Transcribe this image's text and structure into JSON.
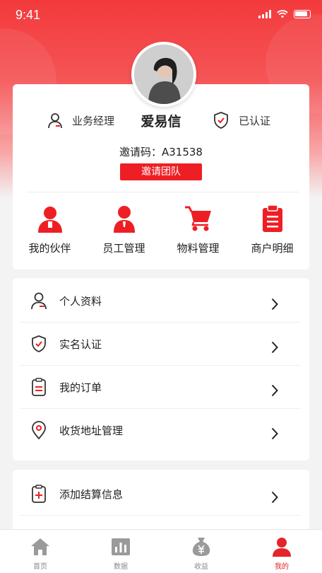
{
  "status_bar": {
    "time": "9:41"
  },
  "profile": {
    "role": "业务经理",
    "name": "爱易信",
    "verified": "已认证",
    "invite_code": "邀请码：A31538",
    "invite_button": "邀请团队"
  },
  "quick_actions": [
    {
      "label": "我的伙伴",
      "icon": "partner-icon"
    },
    {
      "label": "员工管理",
      "icon": "staff-icon"
    },
    {
      "label": "物料管理",
      "icon": "cart-icon"
    },
    {
      "label": "商户明细",
      "icon": "clipboard-icon"
    }
  ],
  "menu": [
    {
      "label": "个人资料",
      "icon": "user-icon"
    },
    {
      "label": "实名认证",
      "icon": "shield-check-icon"
    },
    {
      "label": "我的订单",
      "icon": "order-icon"
    },
    {
      "label": "收货地址管理",
      "icon": "location-icon"
    }
  ],
  "menu2": [
    {
      "label": "添加结算信息",
      "icon": "settlement-icon"
    }
  ],
  "tabs": [
    {
      "label": "首页",
      "icon": "home-icon",
      "active": false
    },
    {
      "label": "数据",
      "icon": "chart-icon",
      "active": false
    },
    {
      "label": "收益",
      "icon": "money-bag-icon",
      "active": false
    },
    {
      "label": "我的",
      "icon": "person-icon",
      "active": true
    }
  ],
  "colors": {
    "accent": "#ee1f24",
    "header": "#f33a3c"
  }
}
